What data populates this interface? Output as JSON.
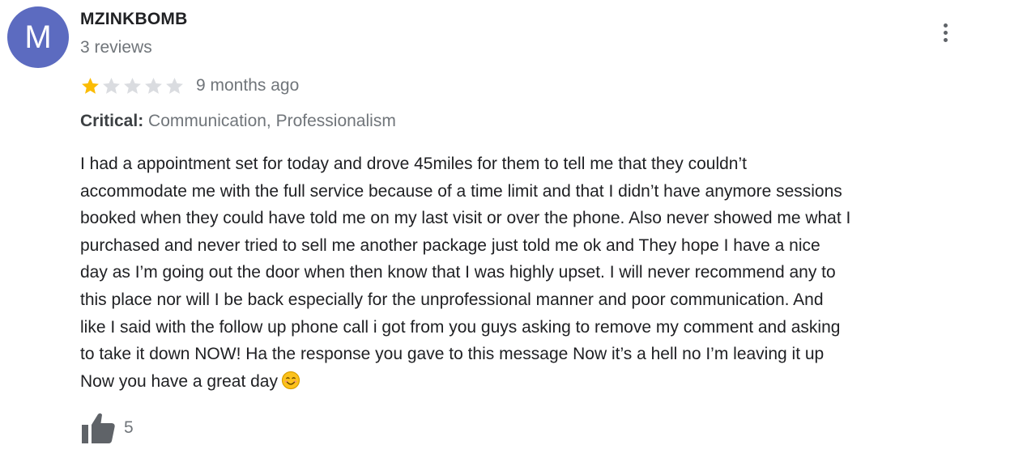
{
  "review": {
    "avatar_letter": "M",
    "avatar_color": "#5c6bc0",
    "author": "MZINKBOMB",
    "review_count": "3 reviews",
    "rating": 1,
    "rating_max": 5,
    "star_filled_color": "#fbbc04",
    "star_empty_color": "#dadce0",
    "date": "9 months ago",
    "critical_label": "Critical:",
    "critical_items": "Communication, Professionalism",
    "text_lines": [
      "I had a appointment set for today and drove 45miles for them to tell me that they couldn’t",
      "accommodate me with the full service because of a time limit and that I didn’t have anymore sessions",
      "booked when they could have told me on my last visit or over the phone. Also never showed me what I",
      "purchased and never tried to sell me another package just told me ok  and They hope I have a nice",
      "day as I’m going out the door when then know that I was highly upset. I will never recommend any to",
      "this place nor will I be back especially for the unprofessional manner and poor communication. And",
      "like I said with the follow up phone call i got from you guys asking to remove my comment and asking",
      "to take it down NOW! Ha the response you gave to this message Now it’s a hell no I’m leaving it up",
      "Now you have a great day"
    ],
    "end_emoji": "smiling-face-icon",
    "like_icon": "thumbs-up-icon",
    "like_count": "5",
    "menu_icon": "more-vert-icon"
  }
}
